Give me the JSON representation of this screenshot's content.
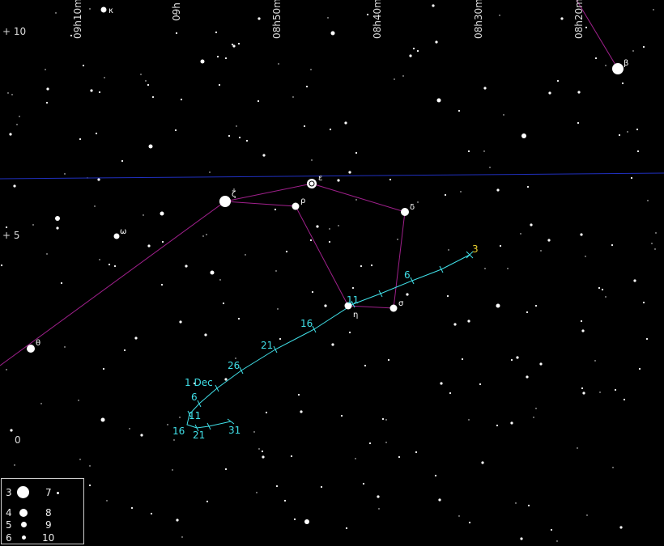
{
  "ra_labels": [
    "09h10m",
    "09h",
    "08h50m",
    "08h40m",
    "08h30m",
    "08h20m"
  ],
  "dec_labels": [
    "+ 10",
    "+ 5",
    "0"
  ],
  "greek_labels": {
    "kappa": "κ",
    "beta": "β",
    "epsilon": "ε",
    "zeta": "ζ",
    "rho": "ρ",
    "delta": "δ",
    "omega": "ω",
    "eta": "η",
    "sigma": "σ",
    "theta": "θ"
  },
  "comet_track_labels": [
    "3",
    "6",
    "11",
    "16",
    "21",
    "26",
    "1 Dec",
    "6",
    "11",
    "16",
    "21",
    "31"
  ],
  "legend": {
    "magnitudes": [
      "3",
      "4",
      "5",
      "6",
      "7",
      "8",
      "9",
      "10"
    ]
  },
  "colors": {
    "background": "#000000",
    "stars": "#ffffff",
    "constellation_lines": "#a0208c",
    "ecliptic": "#2030c0",
    "comet_track": "#40e0e8",
    "comet_start_label": "#e8d030"
  }
}
